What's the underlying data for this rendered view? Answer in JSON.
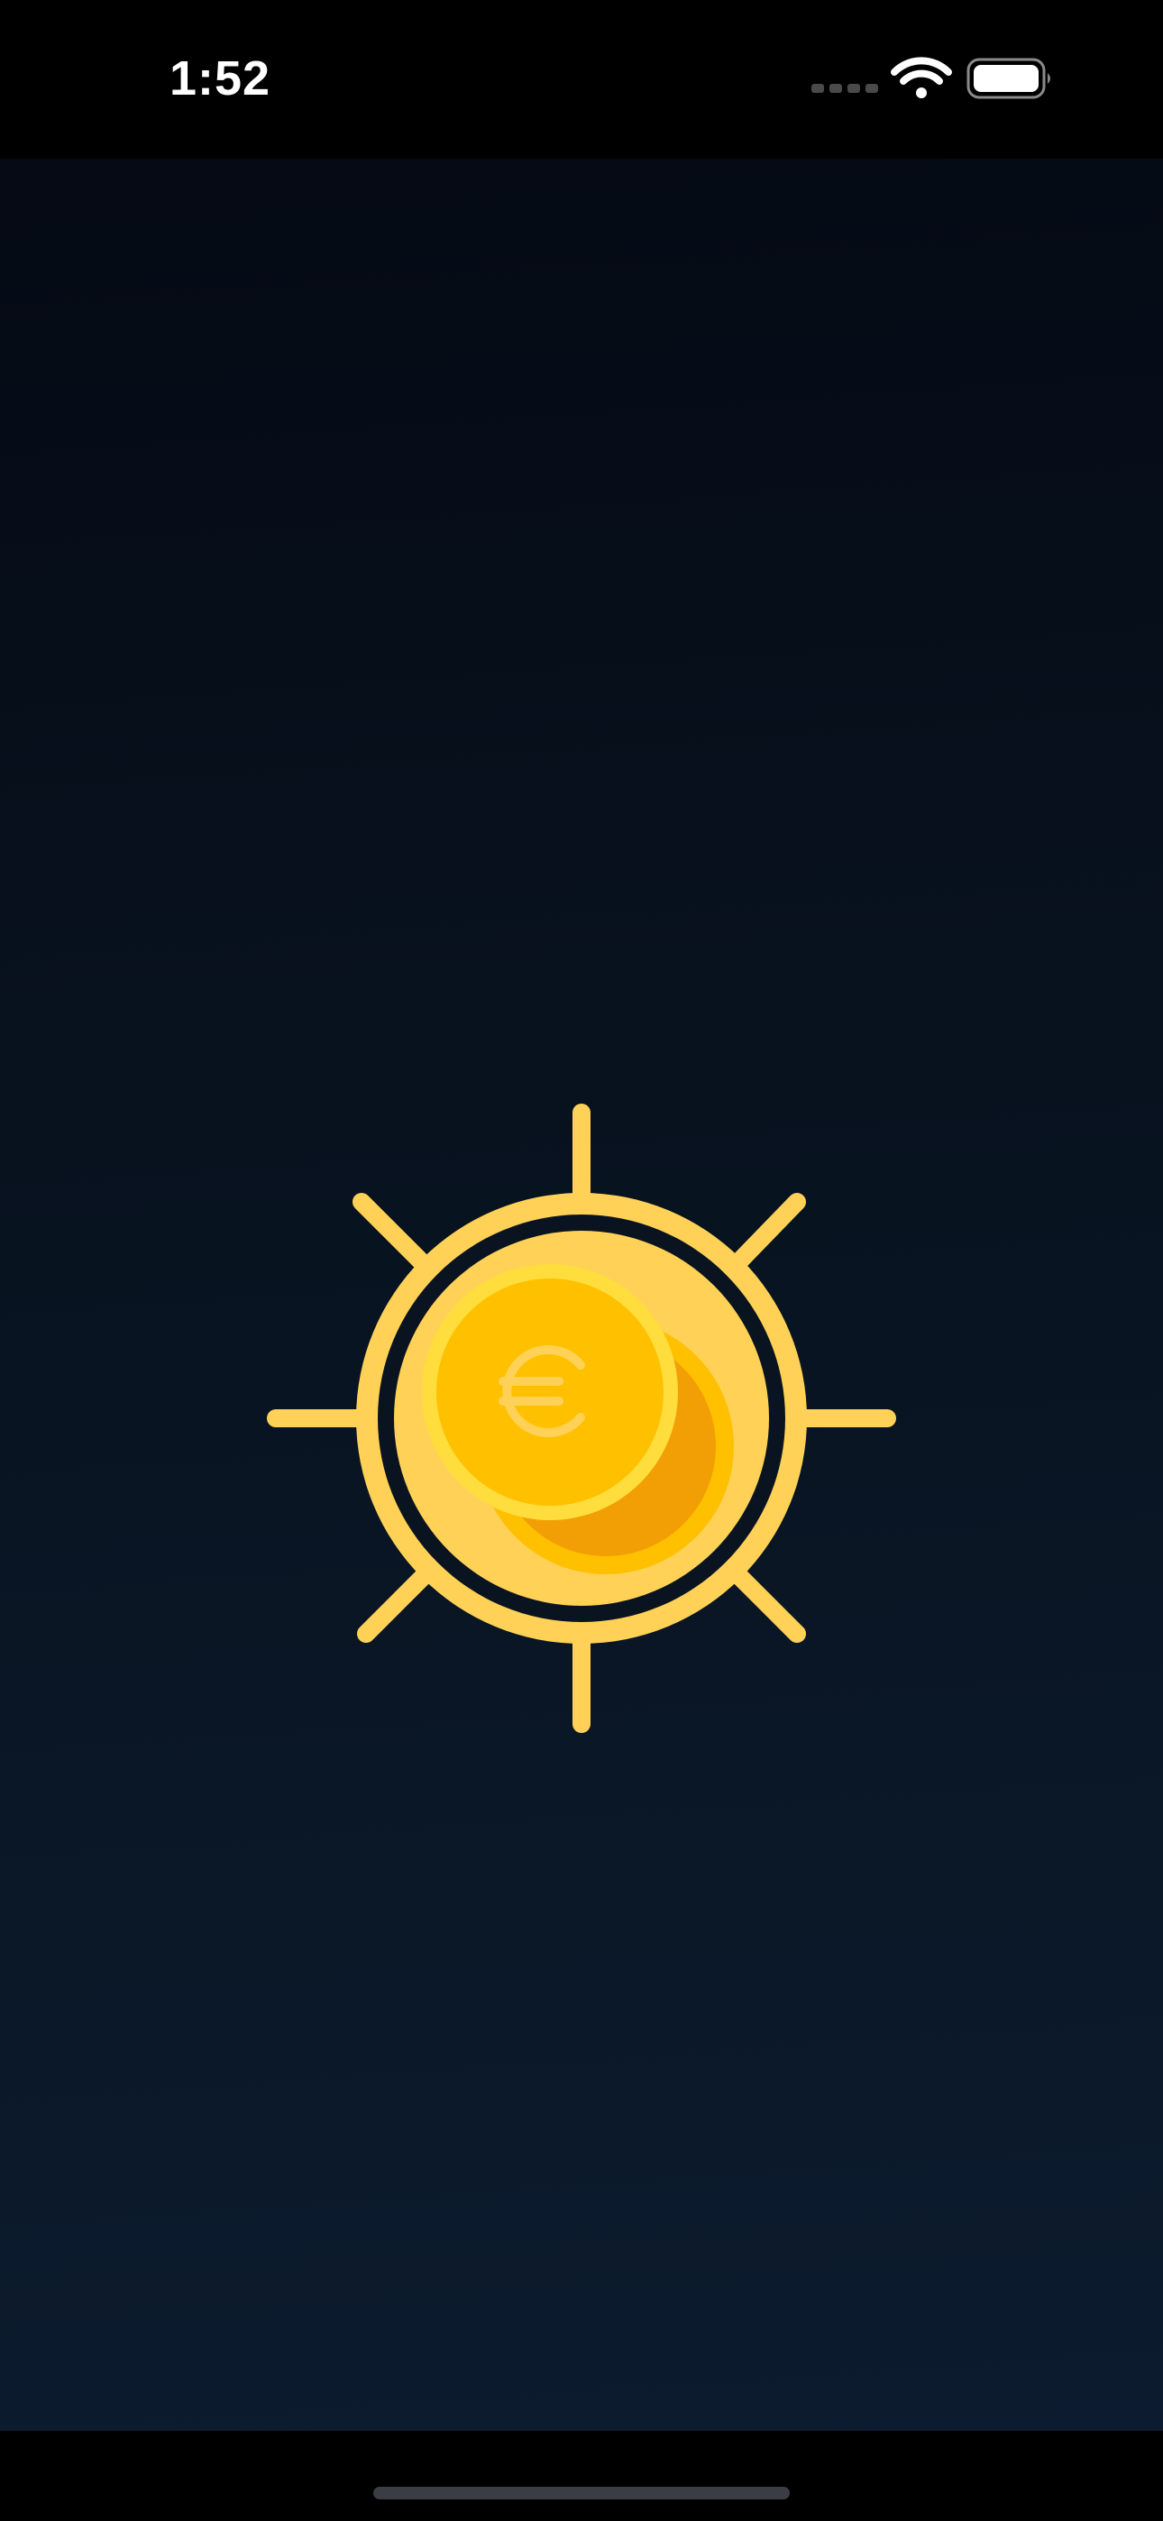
{
  "status_bar": {
    "time": "1:52",
    "signal_icon": "cellular-signal-icon",
    "wifi_icon": "wifi-icon",
    "battery_icon": "battery-icon"
  },
  "splash": {
    "logo_icon": "sun-coin-icon",
    "currency_symbol": "€",
    "colors": {
      "background_top": "#050a14",
      "background_bottom": "#0c1b2f",
      "sun": "#ffd257",
      "coin_front": "#ffc000",
      "coin_rim": "#ffdd3c",
      "coin_back": "#f29f05"
    }
  }
}
